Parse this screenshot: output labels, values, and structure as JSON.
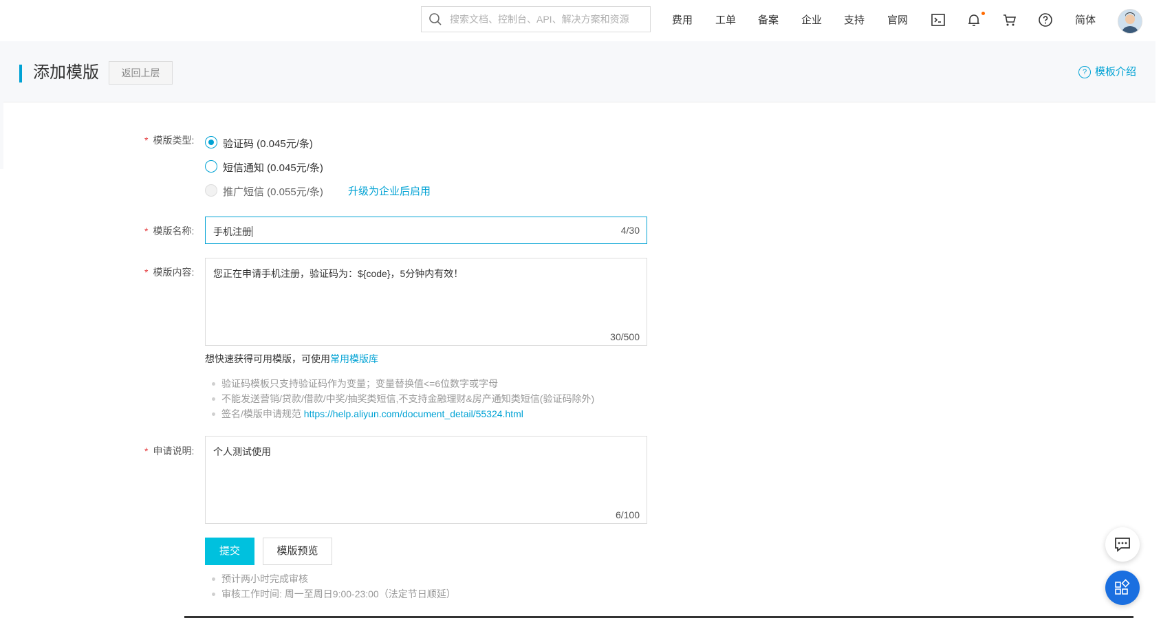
{
  "topbar": {
    "search_placeholder": "搜索文档、控制台、API、解决方案和资源",
    "nav": [
      "费用",
      "工单",
      "备案",
      "企业",
      "支持",
      "官网"
    ],
    "lang": "简体",
    "notif_color": "#ff6a00"
  },
  "header": {
    "title": "添加模版",
    "back_label": "返回上层",
    "intro_label": "模板介绍"
  },
  "form": {
    "required_mark": "*",
    "type_label": "模版类型:",
    "type_options": [
      {
        "label": "验证码 (0.045元/条)",
        "state": "checked"
      },
      {
        "label": "短信通知 (0.045元/条)",
        "state": "unchecked"
      },
      {
        "label": "推广短信 (0.055元/条)",
        "state": "disabled"
      }
    ],
    "upgrade_link": "升级为企业后启用",
    "name_label": "模版名称:",
    "name_value": "手机注册",
    "name_count": "4/30",
    "content_label": "模版内容:",
    "content_value": "您正在申请手机注册，验证码为：${code}，5分钟内有效！",
    "content_count": "30/500",
    "template_hint_prefix": "想快速获得可用模版，可使用",
    "template_hint_link": "常用模版库",
    "rules": [
      "验证码模板只支持验证码作为变量；变量替换值<=6位数字或字母",
      "不能发送营销/贷款/借款/中奖/抽奖类短信,不支持金融理财&房产通知类短信(验证码除外)"
    ],
    "rule_link_prefix": "签名/模版申请规范 ",
    "rule_link_url": "https://help.aliyun.com/document_detail/55324.html",
    "desc_label": "申请说明:",
    "desc_value": "个人测试使用",
    "desc_count": "6/100",
    "submit_label": "提交",
    "preview_label": "模版预览",
    "review_notes": [
      "预计两小时完成审核",
      "审核工作时间: 周一至周日9:00-23:00（法定节日顺延）"
    ]
  },
  "colors": {
    "accent": "#00a2d4",
    "primary_button": "#00c1de",
    "required": "#e4393c"
  }
}
